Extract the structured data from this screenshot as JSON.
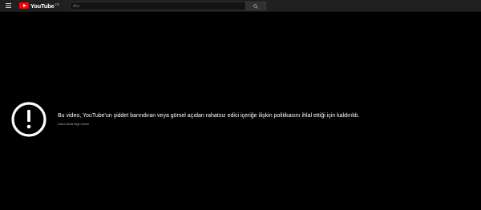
{
  "header": {
    "logo_text": "YouTube",
    "logo_tm": "TR",
    "search_placeholder": "Ara"
  },
  "icons": {
    "menu": "hamburger-menu-icon",
    "search": "search-icon",
    "alert": "alert-circle-icon"
  },
  "colors": {
    "background": "#000000",
    "topbar": "#202020",
    "brand_red": "#ff0000",
    "message_text": "#ffffff",
    "link_text": "#aaaaaa"
  },
  "removed_notice": {
    "message": "Bu video, YouTube'un şiddet barındıran veya görsel açıdan rahatsız edici içeriğe ilişkin politikasını ihlal ettiği için kaldırıldı.",
    "learn_more": "Daha fazla bilgi edinin"
  }
}
